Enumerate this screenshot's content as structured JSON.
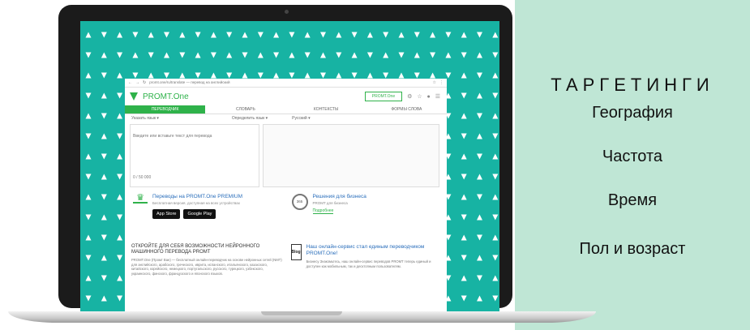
{
  "panel": {
    "title": "ТАРГЕТИНГИ",
    "items": [
      "География",
      "Частота",
      "Время",
      "Пол и возраст"
    ]
  },
  "browser": {
    "url": "promt.one/ru/translate — перевод на английский",
    "brand": "PROMT.One",
    "promt_button": "PROMT.One",
    "header_icons": "⚙ ☆ ● ☰",
    "tabs": [
      "ПЕРЕВОДЧИК",
      "СЛОВАРЬ",
      "КОНТЕКСТЫ",
      "ФОРМЫ СЛОВА"
    ],
    "active_tab": 0,
    "lang_from": "Указать язык ▾",
    "lang_to": "Определить язык ▾",
    "lang_target": "Русский ▾",
    "input_placeholder": "Введите или вставьте текст для перевода",
    "input_counter": "0 / 50 000",
    "promo_premium_title": "Переводы на PROMT.One PREMIUM",
    "promo_premium_text": "Бесплатная версия, доступная на всех устройствах",
    "store_apple": "App Store",
    "store_google": "Google Play",
    "promo_business_title": "Решения для бизнеса",
    "promo_business_text": "PROMT для бизнеса",
    "promo_business_link": "Подробнее",
    "lower_title": "ОТКРОЙТЕ ДЛЯ СЕБЯ ВОЗМОЖНОСТИ НЕЙРОННОГО МАШИННОГО ПЕРЕВОДА PROMT",
    "lower_text": "PROMT.One (Промт Ван) — бесплатный онлайн-переводчик на основе нейронных сетей (NMT) для английского, арабского, греческого, иврита, испанского, итальянского, казахского, китайского, корейского, немецкого, португальского, русского, турецкого, узбекского, украинского, финского, французского и японского языков.",
    "blog_icon": "Blog",
    "blog_title": "Наш онлайн-сервис стал единым переводчиком PROMT.One!",
    "blog_text": "Бизнесу Знакомьтесь, наш онлайн-сервис переводов PROMT теперь единый и доступен как мобильным, так и десктопным пользователям."
  }
}
